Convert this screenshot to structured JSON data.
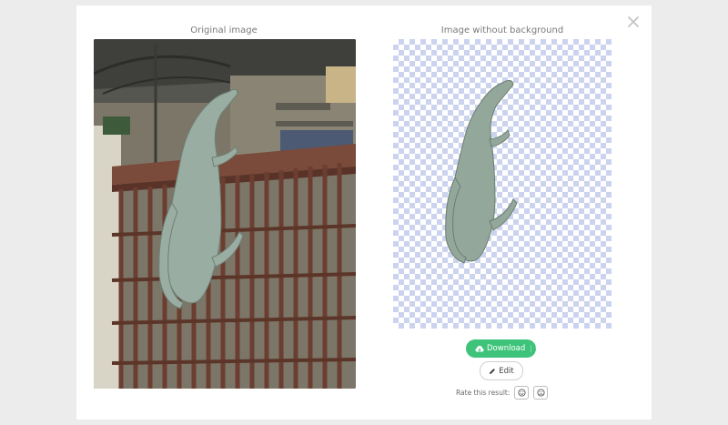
{
  "dialog": {
    "close_icon": "close-icon",
    "original_title": "Original image",
    "result_title": "Image without background"
  },
  "actions": {
    "download_label": "Download",
    "download_icon": "cloud-download-icon",
    "edit_label": "Edit",
    "edit_icon": "pencil-icon"
  },
  "rating": {
    "label": "Rate this result:",
    "good_icon": "smile-icon",
    "bad_icon": "frown-icon"
  },
  "colors": {
    "accent_green": "#3ec47a",
    "checker": "#cbd3ee",
    "lizard": "#8fa398"
  }
}
